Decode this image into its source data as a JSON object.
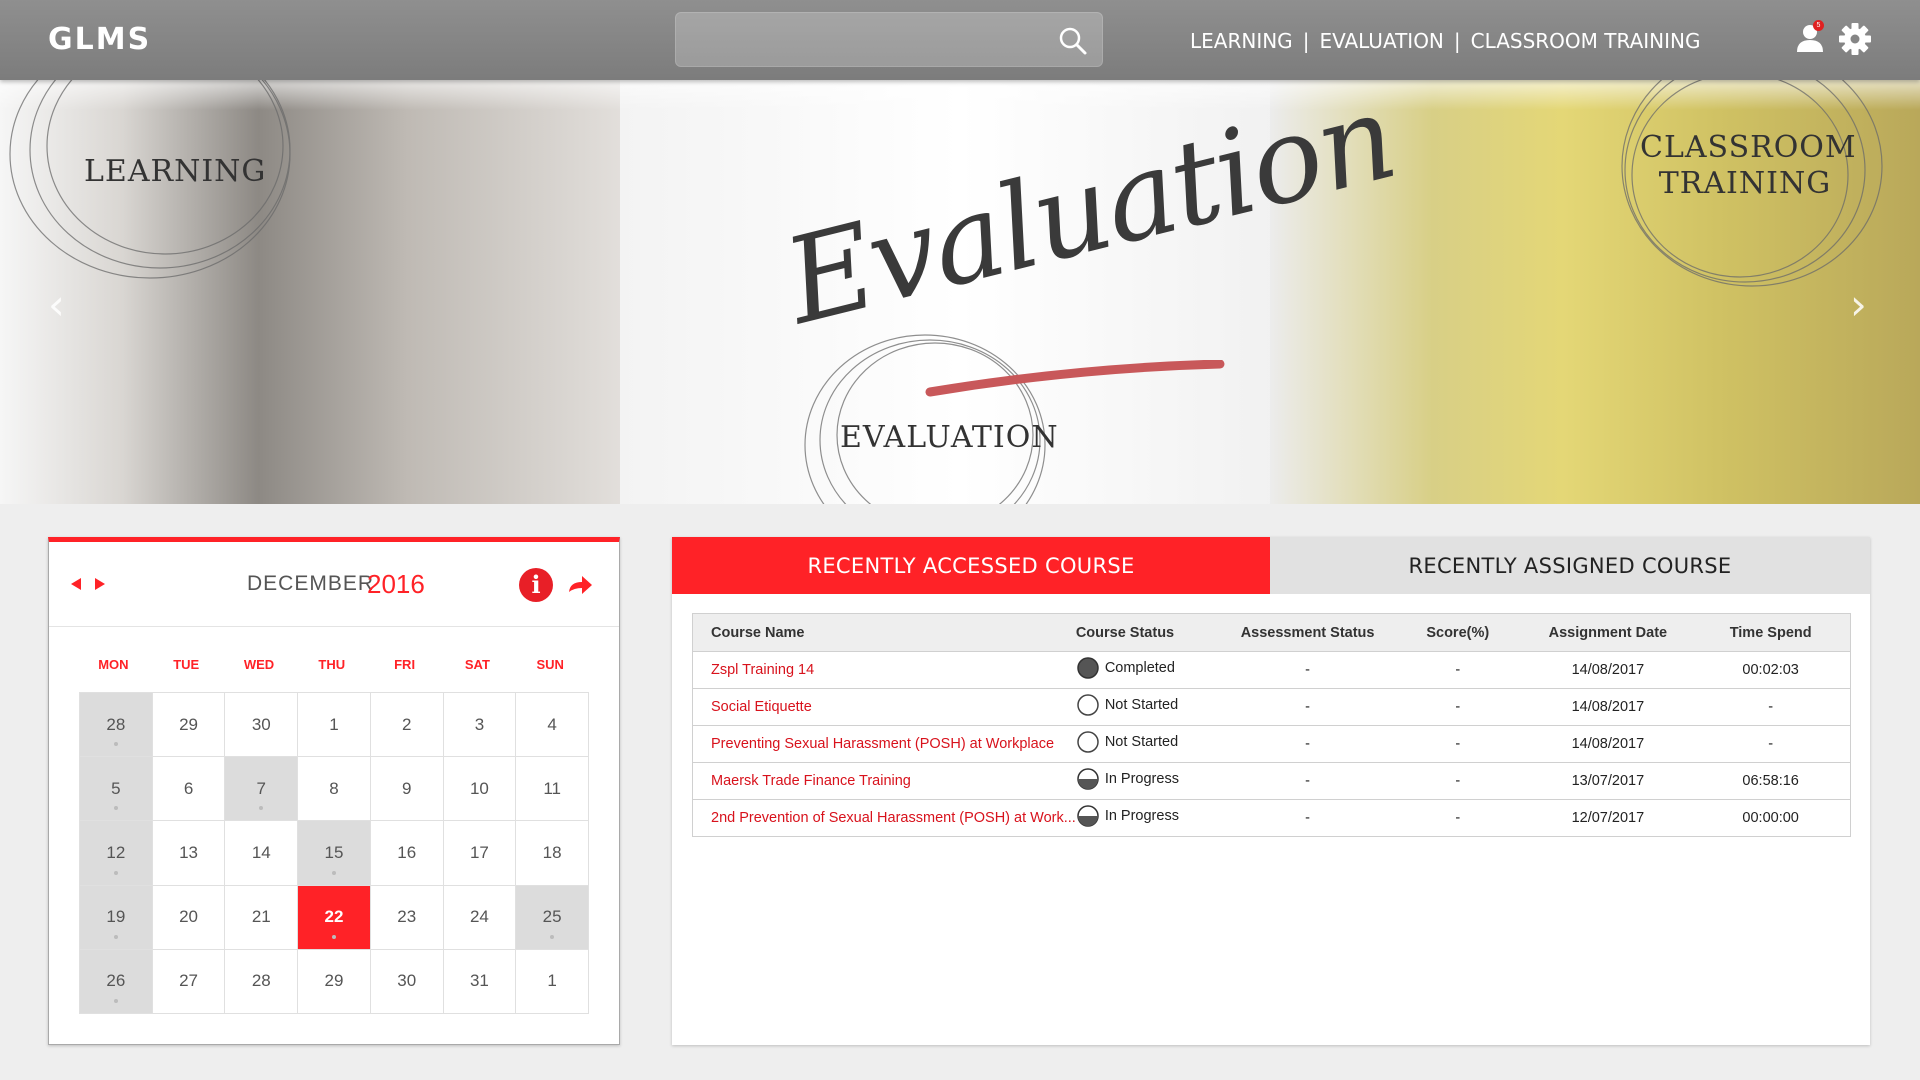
{
  "header": {
    "logo": "GLMS",
    "search_placeholder": "",
    "nav": [
      "LEARNING",
      "EVALUATION",
      "CLASSROOM TRAINING"
    ],
    "nav_separator": "|",
    "notification_count": "5"
  },
  "banner": {
    "learning_label": "LEARNING",
    "evaluation_label": "EVALUATION",
    "classroom_label": "CLASSROOM TRAINING",
    "evaluation_script": "Evaluation"
  },
  "calendar": {
    "month": "DECEMBER",
    "year": "2016",
    "weekdays": [
      "MON",
      "TUE",
      "WED",
      "THU",
      "FRI",
      "SAT",
      "SUN"
    ],
    "days": [
      {
        "d": "28",
        "s": "grey"
      },
      {
        "d": "29",
        "s": ""
      },
      {
        "d": "30",
        "s": ""
      },
      {
        "d": "1",
        "s": ""
      },
      {
        "d": "2",
        "s": ""
      },
      {
        "d": "3",
        "s": ""
      },
      {
        "d": "4",
        "s": ""
      },
      {
        "d": "5",
        "s": "grey"
      },
      {
        "d": "6",
        "s": ""
      },
      {
        "d": "7",
        "s": "grey"
      },
      {
        "d": "8",
        "s": ""
      },
      {
        "d": "9",
        "s": ""
      },
      {
        "d": "10",
        "s": ""
      },
      {
        "d": "11",
        "s": ""
      },
      {
        "d": "12",
        "s": "grey"
      },
      {
        "d": "13",
        "s": ""
      },
      {
        "d": "14",
        "s": ""
      },
      {
        "d": "15",
        "s": "grey"
      },
      {
        "d": "16",
        "s": ""
      },
      {
        "d": "17",
        "s": ""
      },
      {
        "d": "18",
        "s": ""
      },
      {
        "d": "19",
        "s": "grey"
      },
      {
        "d": "20",
        "s": ""
      },
      {
        "d": "21",
        "s": ""
      },
      {
        "d": "22",
        "s": "today"
      },
      {
        "d": "23",
        "s": ""
      },
      {
        "d": "24",
        "s": ""
      },
      {
        "d": "25",
        "s": "grey"
      },
      {
        "d": "26",
        "s": "grey"
      },
      {
        "d": "27",
        "s": ""
      },
      {
        "d": "28",
        "s": ""
      },
      {
        "d": "29",
        "s": ""
      },
      {
        "d": "30",
        "s": ""
      },
      {
        "d": "31",
        "s": ""
      },
      {
        "d": "1",
        "s": ""
      }
    ]
  },
  "courses": {
    "tabs": {
      "recently_accessed": "RECENTLY ACCESSED COURSE",
      "recently_assigned": "RECENTLY ASSIGNED COURSE"
    },
    "columns": [
      "Course Name",
      "Course Status",
      "Assessment Status",
      "Score(%)",
      "Assignment Date",
      "Time Spend"
    ],
    "rows": [
      {
        "name": "Zspl Training 14",
        "status": "Completed",
        "status_icon": "completed-icon",
        "assessment": "-",
        "score": "-",
        "date": "14/08/2017",
        "time": "00:02:03"
      },
      {
        "name": "Social Etiquette",
        "status": "Not Started",
        "status_icon": "not-started-icon",
        "assessment": "-",
        "score": "-",
        "date": "14/08/2017",
        "time": "-"
      },
      {
        "name": "Preventing Sexual Harassment (POSH) at Workplace",
        "status": "Not Started",
        "status_icon": "not-started-icon",
        "assessment": "-",
        "score": "-",
        "date": "14/08/2017",
        "time": "-"
      },
      {
        "name": "Maersk Trade Finance Training",
        "status": "In Progress",
        "status_icon": "in-progress-icon",
        "assessment": "-",
        "score": "-",
        "date": "13/07/2017",
        "time": "06:58:16"
      },
      {
        "name": "2nd Prevention of Sexual Harassment (POSH) at Work...",
        "status": "In Progress",
        "status_icon": "in-progress-icon",
        "assessment": "-",
        "score": "-",
        "date": "12/07/2017",
        "time": "00:00:00"
      }
    ]
  },
  "colors": {
    "accent": "#ff2227",
    "header": "#858585",
    "grey_day": "#dcdcdc",
    "link": "#d8121c"
  }
}
